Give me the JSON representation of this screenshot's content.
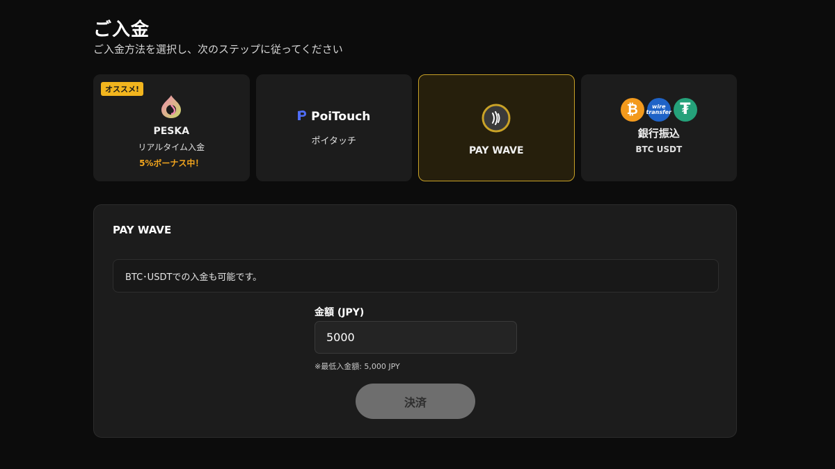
{
  "header": {
    "title": "ご入金",
    "subtitle": "ご入金方法を選択し、次のステップに従ってください"
  },
  "methods": [
    {
      "name": "PESKA",
      "badge": "オススメ!",
      "sub": "リアルタイム入金",
      "bonus": "5%ボーナス中！",
      "icon": "peska-logo-icon"
    },
    {
      "name": "PoiTouch",
      "sub": "ポイタッチ",
      "icon": "poitouch-logo-icon"
    },
    {
      "name": "PAY WAVE",
      "icon": "paywave-icon",
      "selected": true
    },
    {
      "name": "銀行振込",
      "sub": "BTC USDT",
      "icons": [
        "bitcoin-icon",
        "wire-transfer-icon",
        "tether-icon"
      ],
      "wire_text": "wire transfer"
    }
  ],
  "panel": {
    "title": "PAY WAVE",
    "info": "BTC･USDTでの入金も可能です。",
    "amount_label": "金額 (JPY)",
    "amount_value": "5000",
    "min_note": "※最低入金額: 5,000 JPY",
    "submit_label": "決済"
  },
  "colors": {
    "accent": "#f2b51e",
    "selected_border": "#c9a227",
    "bonus": "#f2a51e"
  }
}
